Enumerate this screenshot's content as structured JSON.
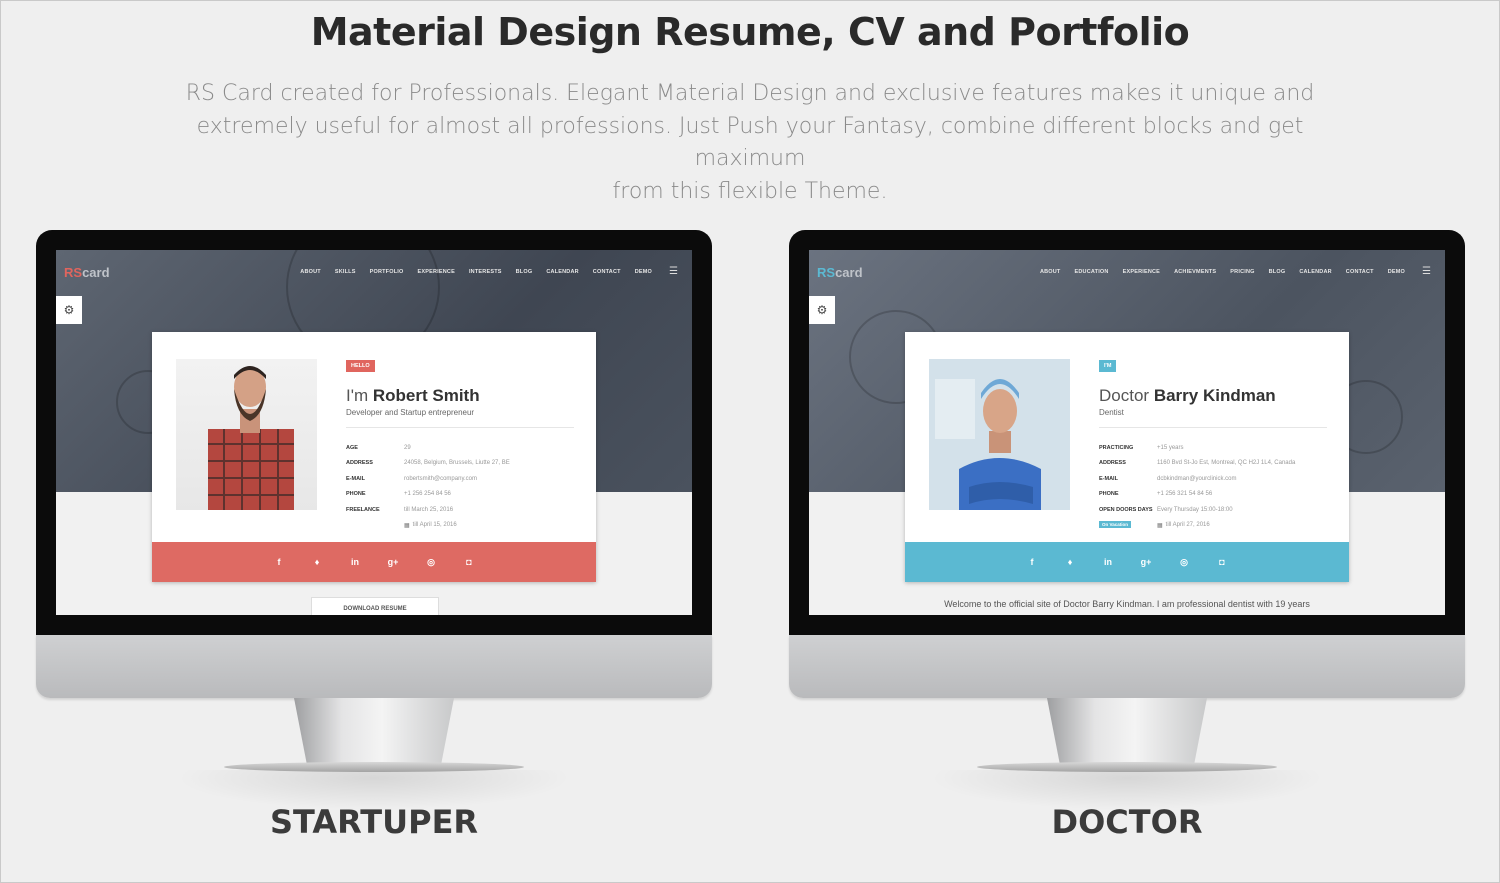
{
  "header": {
    "title": "Material Design Resume, CV and Portfolio",
    "intro_line1": "RS Card created for Professionals. Elegant Material Design and exclusive features makes it unique and",
    "intro_line2": "extremely useful for almost all professions. Just Push your Fantasy, combine different blocks and get maximum",
    "intro_line3": "from this flexible Theme."
  },
  "startuper": {
    "label": "STARTUPER",
    "logo_rs": "RS",
    "logo_card": "card",
    "nav": [
      "ABOUT",
      "SKILLS",
      "PORTFOLIO",
      "EXPERIENCE",
      "INTERESTS",
      "BLOG",
      "CALENDAR",
      "CONTACT",
      "DEMO"
    ],
    "tag": "HELLO",
    "name_prefix": "I'm",
    "name": "Robert Smith",
    "role": "Developer and Startup entrepreneur",
    "info": [
      {
        "key": "AGE",
        "value": "29"
      },
      {
        "key": "ADDRESS",
        "value": "24058, Belgium, Brussels, Liutte 27, BE"
      },
      {
        "key": "E-MAIL",
        "value": "robertsmith@company.com"
      },
      {
        "key": "PHONE",
        "value": "+1 256 254 84 56"
      },
      {
        "key": "FREELANCE",
        "value": "till March 25, 2016"
      },
      {
        "key": "",
        "value": "till April 15, 2016"
      }
    ],
    "download": "DOWNLOAD RESUME"
  },
  "doctor": {
    "label": "DOCTOR",
    "logo_rs": "RS",
    "logo_card": "card",
    "nav": [
      "ABOUT",
      "EDUCATION",
      "EXPERIENCE",
      "ACHIEVMENTS",
      "PRICING",
      "BLOG",
      "CALENDAR",
      "CONTACT",
      "DEMO"
    ],
    "tag": "I'M",
    "name_prefix": "Doctor",
    "name": "Barry Kindman",
    "role": "Dentist",
    "info": [
      {
        "key": "PRACTICING",
        "value": "+15 years"
      },
      {
        "key": "ADDRESS",
        "value": "1160 Bvd St-Jo Est, Montreal, QC H2J 1L4, Canada"
      },
      {
        "key": "E-MAIL",
        "value": "dcbkindman@yourclinick.com"
      },
      {
        "key": "PHONE",
        "value": "+1 256 321 54 84 56"
      },
      {
        "key": "OPEN DOORS DAYS",
        "value": "Every Thursday 15:00-18:00"
      },
      {
        "key": "On Vacation",
        "value": "till April 27, 2016"
      }
    ],
    "welcome": "Welcome to the official site of Doctor Barry Kindman. I am professional dentist with 19 years"
  },
  "icons": [
    "settings-icon",
    "menu-icon",
    "facebook-icon",
    "twitter-icon",
    "linkedin-icon",
    "google-plus-icon",
    "dribbble-icon",
    "instagram-icon",
    "calendar-icon"
  ],
  "colors": {
    "startuper_accent": "#e0655e",
    "doctor_accent": "#5bb9d2"
  }
}
